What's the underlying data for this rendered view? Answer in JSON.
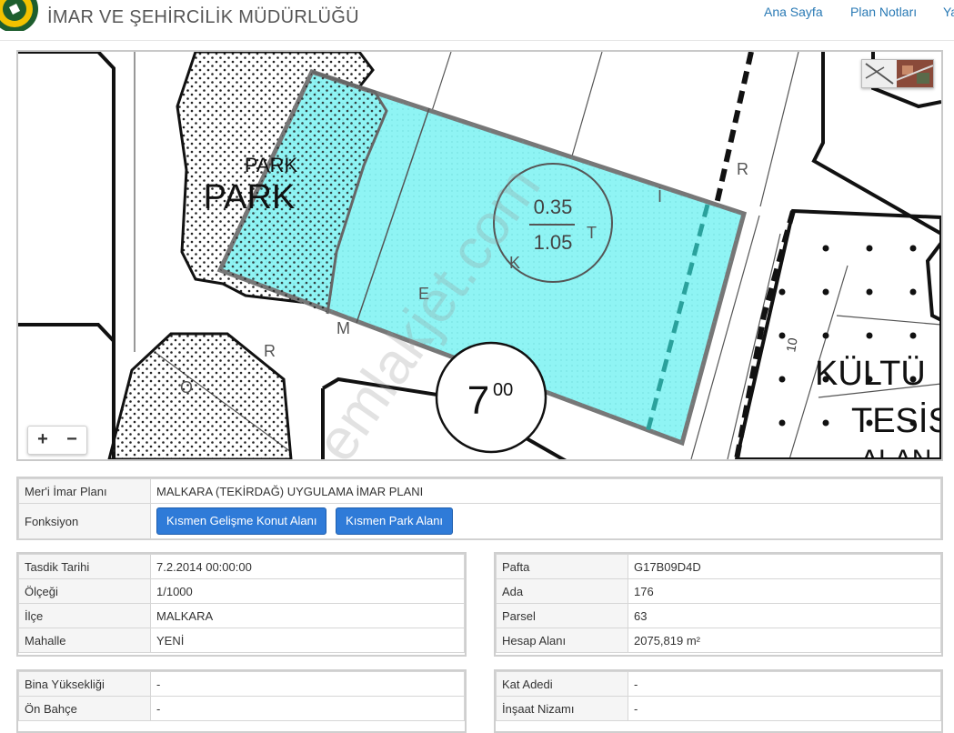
{
  "header": {
    "title": "İMAR VE ŞEHİRCİLİK MÜDÜRLÜĞÜ",
    "nav": [
      "Ana Sayfa",
      "Plan Notları",
      "Ya"
    ]
  },
  "map": {
    "labels": {
      "park_1": "PARK",
      "park_2": "PARK",
      "ratio_top": "0.35",
      "ratio_bottom": "1.05",
      "road_width": "7",
      "road_width_sup": "00",
      "building_1": "KÜLTÜ",
      "building_2": "TESİS",
      "building_3": "ALAN",
      "small_number": "10",
      "street_letters": [
        "O",
        "R",
        "M",
        "E",
        "K",
        "T",
        "İ",
        "R"
      ],
      "watermark": "emlakjet.com"
    },
    "zoom": {
      "in": "+",
      "out": "−"
    },
    "colors": {
      "parcel_fill": "#8ff4f4",
      "parcel_stroke": "#777777"
    }
  },
  "plan_table": {
    "rows": [
      {
        "label": "Mer'i İmar Planı",
        "value": "MALKARA (TEKİRDAĞ) UYGULAMA İMAR PLANI"
      },
      {
        "label": "Fonksiyon",
        "buttons": [
          "Kısmen Gelişme Konut Alanı",
          "Kısmen Park Alanı"
        ]
      }
    ]
  },
  "left_table": {
    "rows": [
      {
        "label": "Tasdik Tarihi",
        "value": "7.2.2014 00:00:00"
      },
      {
        "label": "Ölçeği",
        "value": "1/1000"
      },
      {
        "label": "İlçe",
        "value": "MALKARA"
      },
      {
        "label": "Mahalle",
        "value": "YENİ"
      }
    ]
  },
  "right_table": {
    "rows": [
      {
        "label": "Pafta",
        "value": "G17B09D4D"
      },
      {
        "label": "Ada",
        "value": "176"
      },
      {
        "label": "Parsel",
        "value": "63"
      },
      {
        "label": "Hesap Alanı",
        "value": "2075,819 m²"
      }
    ]
  },
  "left_table2": {
    "rows": [
      {
        "label": "Bina Yüksekliği",
        "value": "-"
      },
      {
        "label": "Ön Bahçe",
        "value": "-"
      }
    ]
  },
  "right_table2": {
    "rows": [
      {
        "label": "Kat Adedi",
        "value": "-"
      },
      {
        "label": "İnşaat Nizamı",
        "value": "-"
      }
    ]
  }
}
